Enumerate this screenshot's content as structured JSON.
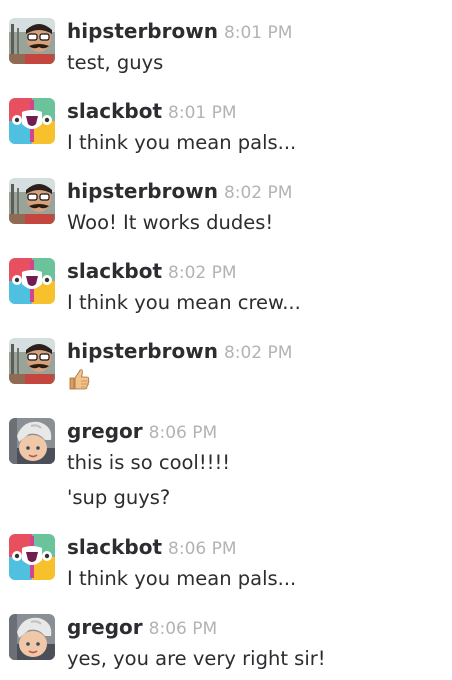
{
  "messages": [
    {
      "author": "hipsterbrown",
      "time": "8:01 PM",
      "lines": [
        "test, guys"
      ],
      "avatar_icon": "hipster-avatar"
    },
    {
      "author": "slackbot",
      "time": "8:01 PM",
      "lines": [
        "I think you mean pals..."
      ],
      "avatar_icon": "slackbot-avatar"
    },
    {
      "author": "hipsterbrown",
      "time": "8:02 PM",
      "lines": [
        "Woo! It works dudes!"
      ],
      "avatar_icon": "hipster-avatar"
    },
    {
      "author": "slackbot",
      "time": "8:02 PM",
      "lines": [
        "I think you mean crew..."
      ],
      "avatar_icon": "slackbot-avatar"
    },
    {
      "author": "hipsterbrown",
      "time": "8:02 PM",
      "lines": [],
      "emoji": "thumbs-up-icon",
      "avatar_icon": "hipster-avatar"
    },
    {
      "author": "gregor",
      "time": "8:06 PM",
      "lines": [
        "this is so cool!!!!",
        "'sup guys?"
      ],
      "avatar_icon": "gregor-avatar"
    },
    {
      "author": "slackbot",
      "time": "8:06 PM",
      "lines": [
        "I think you mean pals..."
      ],
      "avatar_icon": "slackbot-avatar"
    },
    {
      "author": "gregor",
      "time": "8:06 PM",
      "lines": [
        "yes, you are very right sir!"
      ],
      "avatar_icon": "gregor-avatar"
    }
  ],
  "colors": {
    "author": "#2c2d30",
    "timestamp": "#b3b3b3",
    "text": "#2c2d30"
  }
}
